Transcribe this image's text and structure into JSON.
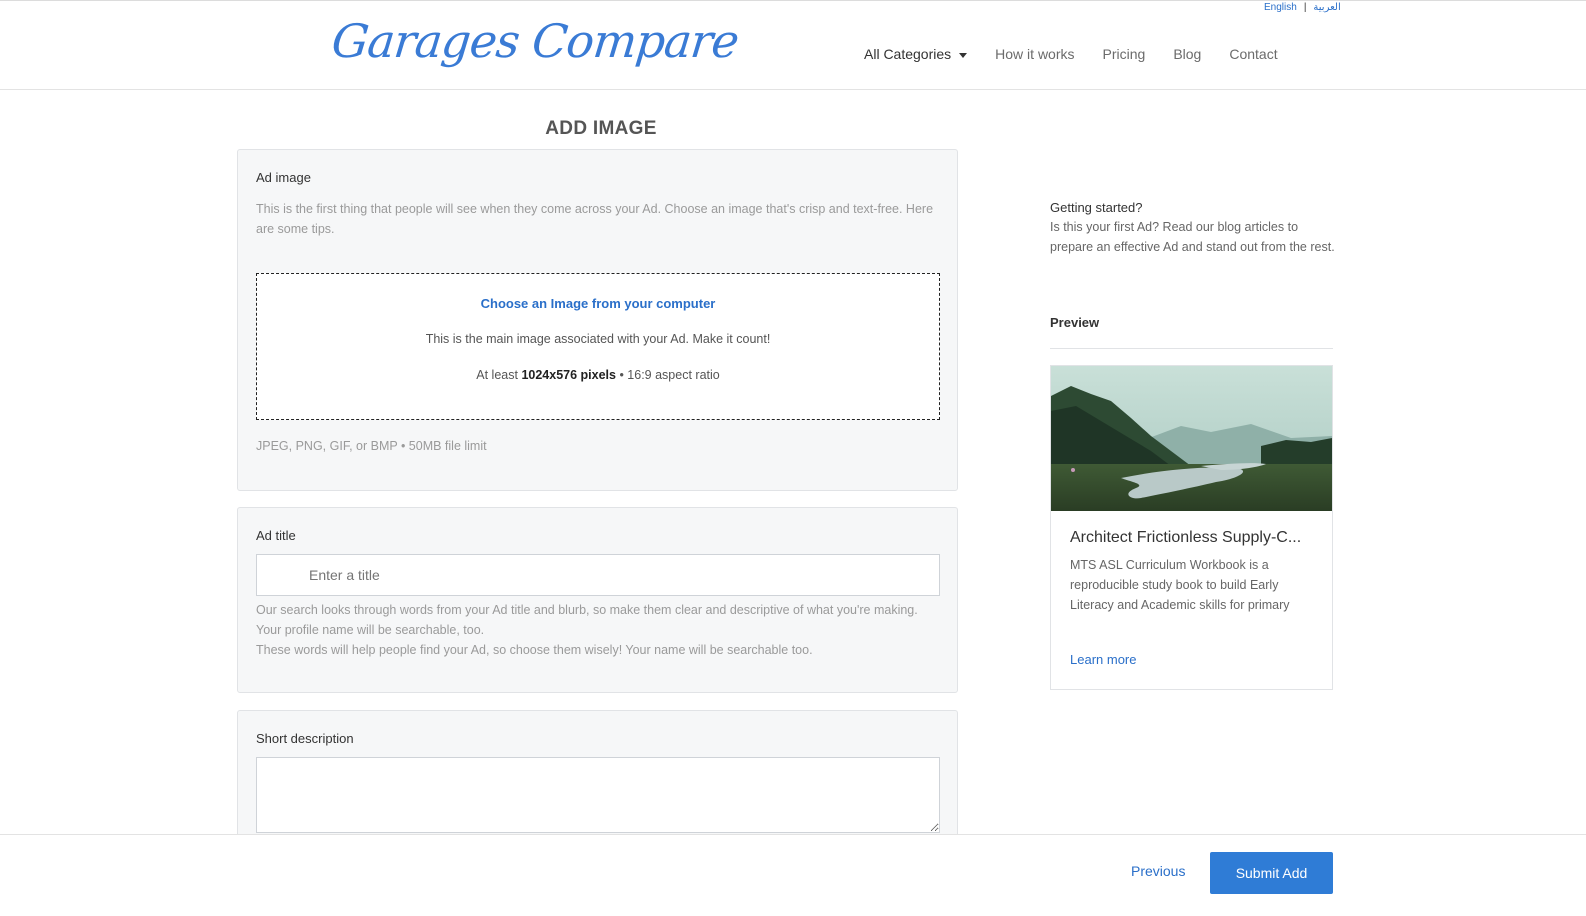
{
  "header": {
    "logo_text": "Garages Compare",
    "lang": {
      "english": "English",
      "separator": "|",
      "arabic": "العربية"
    },
    "nav": [
      {
        "label": "All Categories"
      },
      {
        "label": "How it works"
      },
      {
        "label": "Pricing"
      },
      {
        "label": "Blog"
      },
      {
        "label": "Contact"
      }
    ]
  },
  "page_title": "ADD IMAGE",
  "ad_image": {
    "label": "Ad image",
    "help": "This is the first thing that people will see when they come across your Ad. Choose an image that's crisp and text-free. Here are some tips.",
    "choose_link": "Choose an Image from your computer",
    "main_text": "This is the main image associated with your Ad. Make it count!",
    "size_prefix": "At least",
    "size_value": "1024x576 pixels",
    "size_suffix": "• 16:9 aspect ratio",
    "file_limit": "JPEG, PNG, GIF, or BMP • 50MB file limit"
  },
  "ad_title": {
    "label": "Ad title",
    "placeholder": "Enter a title",
    "help1": "Our search looks through words from your Ad title and blurb, so make them clear and descriptive of what you're making. Your profile name will be searchable, too.",
    "help2": "These words will help people find your Ad, so choose them wisely! Your name will be searchable too."
  },
  "short_description": {
    "label": "Short description"
  },
  "sidebar": {
    "getting_started_title": "Getting started?",
    "getting_started_text": "Is this your first Ad? Read our blog articles to prepare an effective Ad and stand out from the rest.",
    "preview_label": "Preview",
    "card": {
      "title": "Architect Frictionless Supply-C...",
      "desc": "MTS ASL Curriculum Workbook is a reproducible study book to build Early Literacy and Academic skills for primary",
      "link": "Learn more"
    }
  },
  "footer": {
    "previous": "Previous",
    "submit": "Submit Add"
  },
  "colors": {
    "accent": "#2f7cd6",
    "link": "#2a6fc9",
    "card_bg": "#f6f7f8"
  }
}
